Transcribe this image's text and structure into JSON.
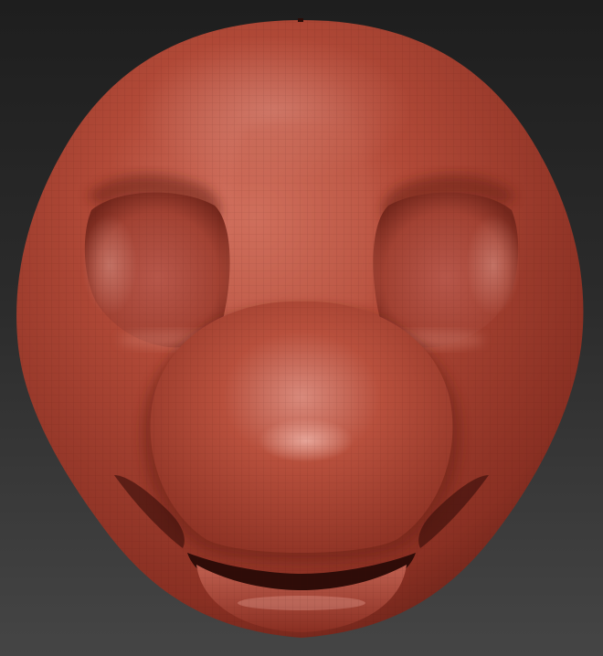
{
  "scene": {
    "subject": "sculpted-head-mesh",
    "background_color_top": "#1e1e1e",
    "background_color_bottom": "#454545",
    "material_color": "#b24a38",
    "material_shadow_color": "#5e1d14",
    "material_highlight_color": "#e7a398",
    "mouth_color": "#2e0c08",
    "wireframe_visible": true
  }
}
